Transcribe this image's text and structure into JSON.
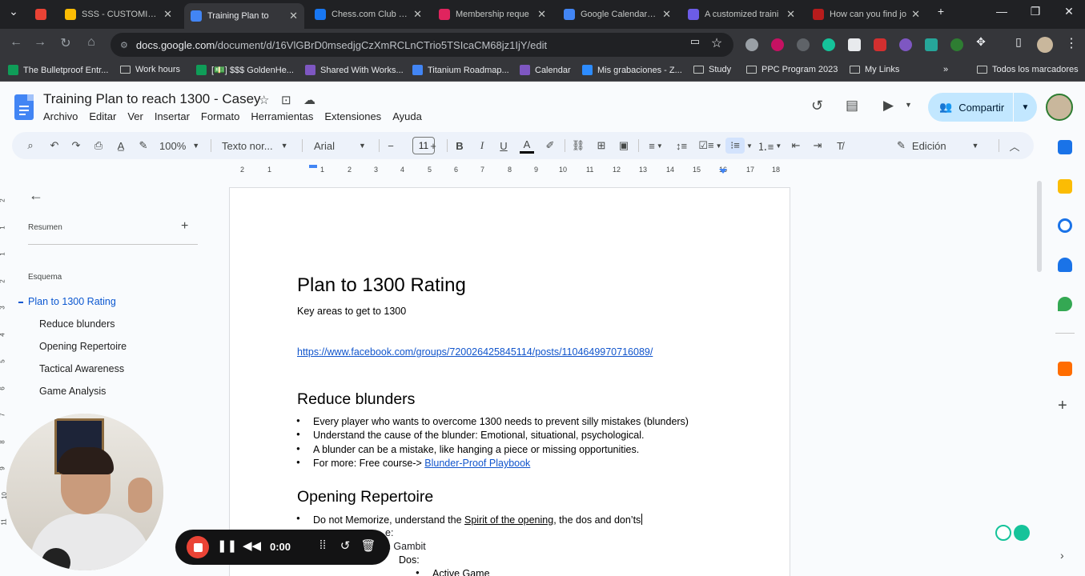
{
  "browser": {
    "tabs": [
      {
        "label": "",
        "color": "#ea4335",
        "icon": "record-icon"
      },
      {
        "label": "SSS - CUSTOMIZED",
        "color": "#fbbc04",
        "icon": "drive-icon"
      },
      {
        "label": "Training Plan to",
        "color": "#4285f4",
        "icon": "docs-icon",
        "active": true
      },
      {
        "label": "Chess.com Club - L",
        "color": "#1877f2",
        "icon": "facebook-icon"
      },
      {
        "label": "Membership reque",
        "color": "#e0245e",
        "icon": "sk-icon"
      },
      {
        "label": "Google Calendar - V",
        "color": "#4285f4",
        "icon": "calendar-icon"
      },
      {
        "label": "A customized traini",
        "color": "#6c5ce7",
        "icon": "gear-icon"
      },
      {
        "label": "How can you find jo",
        "color": "#b71c1c",
        "icon": "shield-icon"
      }
    ],
    "url_host": "docs.google.com",
    "url_path": "/document/d/16VlGBrD0msedjgCzXmRCLnCTrio5TSIcaCM68jz1IjY/edit",
    "bookmarks": [
      {
        "label": "The Bulletproof Entr...",
        "kind": "sheet"
      },
      {
        "label": "Work hours",
        "kind": "folder"
      },
      {
        "label": "[💵] $$$ GoldenHe...",
        "kind": "sheet"
      },
      {
        "label": "Shared With Works...",
        "kind": "app"
      },
      {
        "label": "Titanium Roadmap...",
        "kind": "doc"
      },
      {
        "label": "Calendar",
        "kind": "app"
      },
      {
        "label": "Mis grabaciones - Z...",
        "kind": "zoom"
      },
      {
        "label": "Study",
        "kind": "folder"
      },
      {
        "label": "PPC Program 2023",
        "kind": "folder"
      },
      {
        "label": "My Links",
        "kind": "folder"
      }
    ],
    "bookmarks_all": "Todos los marcadores"
  },
  "docs": {
    "title": "Training Plan to reach 1300 -  Casey",
    "menu": [
      "Archivo",
      "Editar",
      "Ver",
      "Insertar",
      "Formato",
      "Herramientas",
      "Extensiones",
      "Ayuda"
    ],
    "share_label": "Compartir",
    "toolbar": {
      "zoom": "100%",
      "style": "Texto nor...",
      "font": "Arial",
      "font_size": "11",
      "mode": "Edición"
    },
    "ruler_ticks": [
      "2",
      "1",
      "1",
      "2",
      "3",
      "4",
      "5",
      "6",
      "7",
      "8",
      "9",
      "10",
      "11",
      "12",
      "13",
      "14",
      "15",
      "16",
      "17",
      "18"
    ],
    "vruler_ticks": [
      "2",
      "1",
      "1",
      "2",
      "3",
      "4",
      "5",
      "6",
      "7",
      "8",
      "9",
      "10",
      "11"
    ]
  },
  "sidebar": {
    "summary_label": "Resumen",
    "outline_label": "Esquema",
    "outline": [
      {
        "label": "Plan to 1300 Rating",
        "active": true
      },
      {
        "label": "Reduce blunders"
      },
      {
        "label": "Opening Repertoire"
      },
      {
        "label": "Tactical Awareness"
      },
      {
        "label": "Game Analysis"
      }
    ]
  },
  "document": {
    "heading": "Plan to 1300 Rating",
    "subtitle": "Key areas to get to 1300",
    "link": "https://www.facebook.com/groups/720026425845114/posts/1104649970716089/",
    "section1": {
      "heading": "Reduce blunders",
      "bullets": [
        "Every player who wants to overcome 1300 needs to prevent silly mistakes (blunders)",
        "Understand the cause of the blunder: Emotional, situational, psychological.",
        "A blunder can be a mistake, like hanging a piece or missing opportunities."
      ],
      "more_prefix": "For more: Free course-> ",
      "more_link": "Blunder-Proof Playbook"
    },
    "section2": {
      "heading": "Opening Repertoire",
      "bullet_prefix": "Do not Memorize, understand the ",
      "bullet_link": "Spirit of the opening",
      "bullet_suffix": ", the dos and don’ts",
      "sub1": "e:",
      "sub2": "n Gambit",
      "sub3": "Dos:",
      "sub4": "Active Game"
    }
  },
  "recorder": {
    "time": "0:00"
  }
}
